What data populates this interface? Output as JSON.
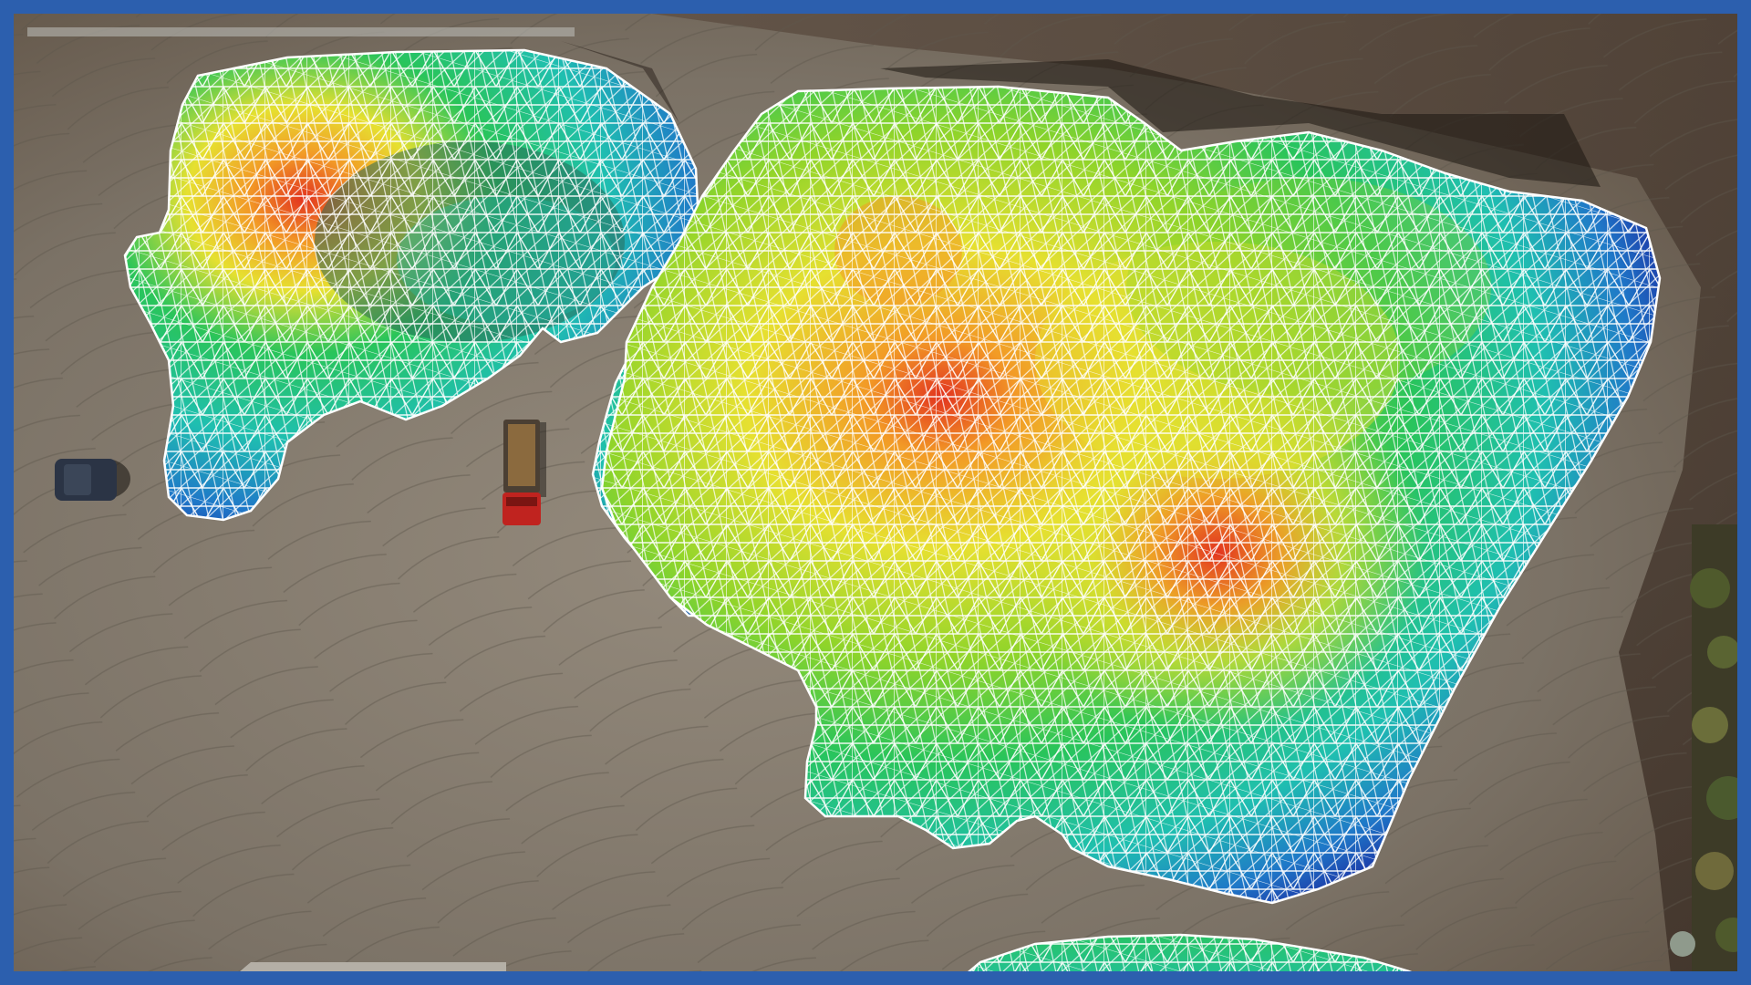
{
  "image": {
    "kind": "aerial drone photograph with stockpile elevation heatmap overlay",
    "frame_color": "#2c5fae",
    "colors": {
      "ground_light": "#8f8578",
      "ground_mid": "#6e6559",
      "ground_dark": "#4a3d31",
      "mesh_line": "#ffffff",
      "truck_red": "#c0231f",
      "truck_bed": "#8b6a3e",
      "car": "#2b3445",
      "vegetation": "#4f5a2c"
    },
    "elevation_colormap": [
      "#1c2fa3",
      "#1f78c8",
      "#1fbfb0",
      "#29c45a",
      "#8fd42a",
      "#e6e030",
      "#f29a26",
      "#e2341f"
    ],
    "stockpiles": [
      {
        "name": "stockpile-left",
        "peak_level": 1.0
      },
      {
        "name": "stockpile-right",
        "peak_level": 1.0
      },
      {
        "name": "stockpile-bottom",
        "peak_level": 0.35
      }
    ]
  }
}
